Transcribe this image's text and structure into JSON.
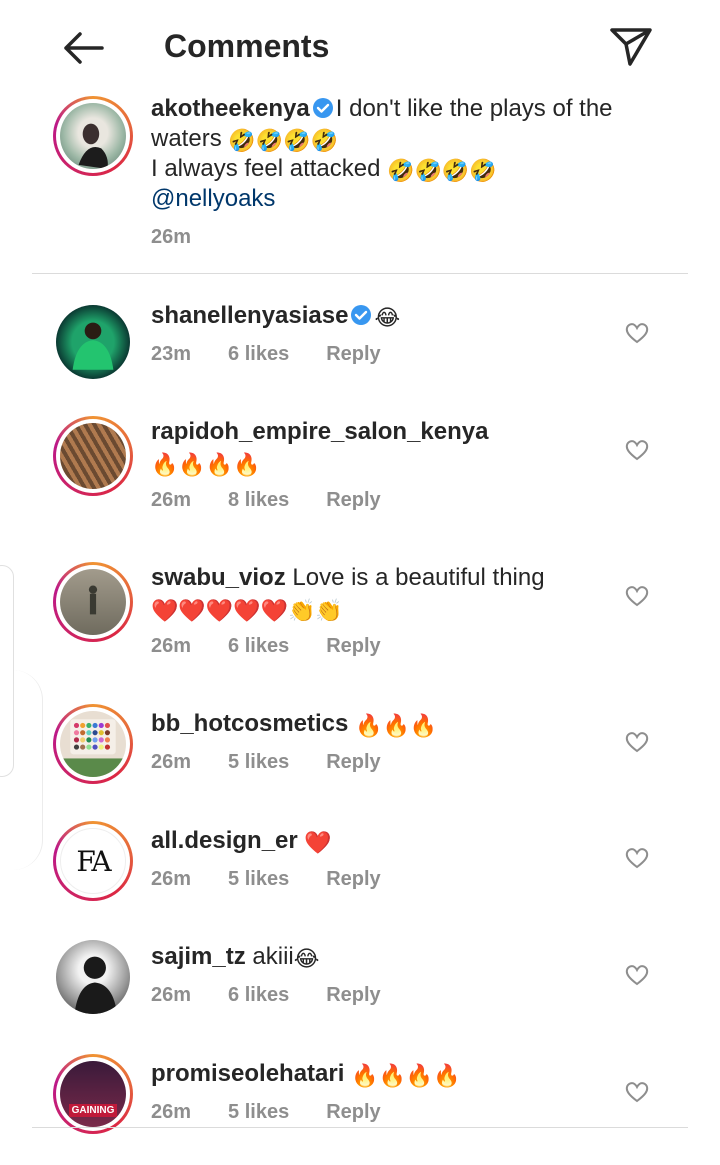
{
  "header": {
    "title": "Comments",
    "back_icon": "arrow-left-icon",
    "send_icon": "paper-plane-icon"
  },
  "caption": {
    "username": "akotheekenya",
    "verified": true,
    "text_line1": "I don't like the plays of the waters",
    "text_line1_emojis": "🤣🤣🤣🤣",
    "text_line2": "I always feel attacked",
    "text_line2_emojis": "🤣🤣🤣🤣",
    "mention": "@nellyoaks",
    "time": "26m"
  },
  "comments": [
    {
      "username": "shanellenyasiase",
      "verified": true,
      "text": "",
      "emojis": "😂",
      "time": "23m",
      "likes": "6 likes",
      "reply": "Reply",
      "ring": false
    },
    {
      "username": "rapidoh_empire_salon_kenya",
      "verified": false,
      "text": "",
      "emojis": "🔥🔥🔥🔥",
      "time": "26m",
      "likes": "8 likes",
      "reply": "Reply",
      "ring": true
    },
    {
      "username": "swabu_vioz",
      "verified": false,
      "text": "Love is a beautiful thing",
      "emojis": "❤️❤️❤️❤️❤️👏👏",
      "time": "26m",
      "likes": "6 likes",
      "reply": "Reply",
      "ring": true
    },
    {
      "username": "bb_hotcosmetics",
      "verified": false,
      "text": "",
      "emojis": "🔥🔥🔥",
      "time": "26m",
      "likes": "5 likes",
      "reply": "Reply",
      "ring": true
    },
    {
      "username": "all.design_er",
      "verified": false,
      "text": "",
      "emojis": "❤️",
      "time": "26m",
      "likes": "5 likes",
      "reply": "Reply",
      "ring": true
    },
    {
      "username": "sajim_tz",
      "verified": false,
      "text": "akiii",
      "emojis": "😂",
      "time": "26m",
      "likes": "6 likes",
      "reply": "Reply",
      "ring": false
    },
    {
      "username": "promiseolehatari",
      "verified": false,
      "text": "",
      "emojis": "🔥🔥🔥🔥",
      "time": "26m",
      "likes": "5 likes",
      "reply": "Reply",
      "ring": true
    }
  ],
  "avatar_texts": {
    "all_design_logo": "FA",
    "promise_badge": "GAINING"
  },
  "colors": {
    "verified": "#3897f0",
    "mention": "#00376b",
    "meta": "#8e8e8e"
  }
}
